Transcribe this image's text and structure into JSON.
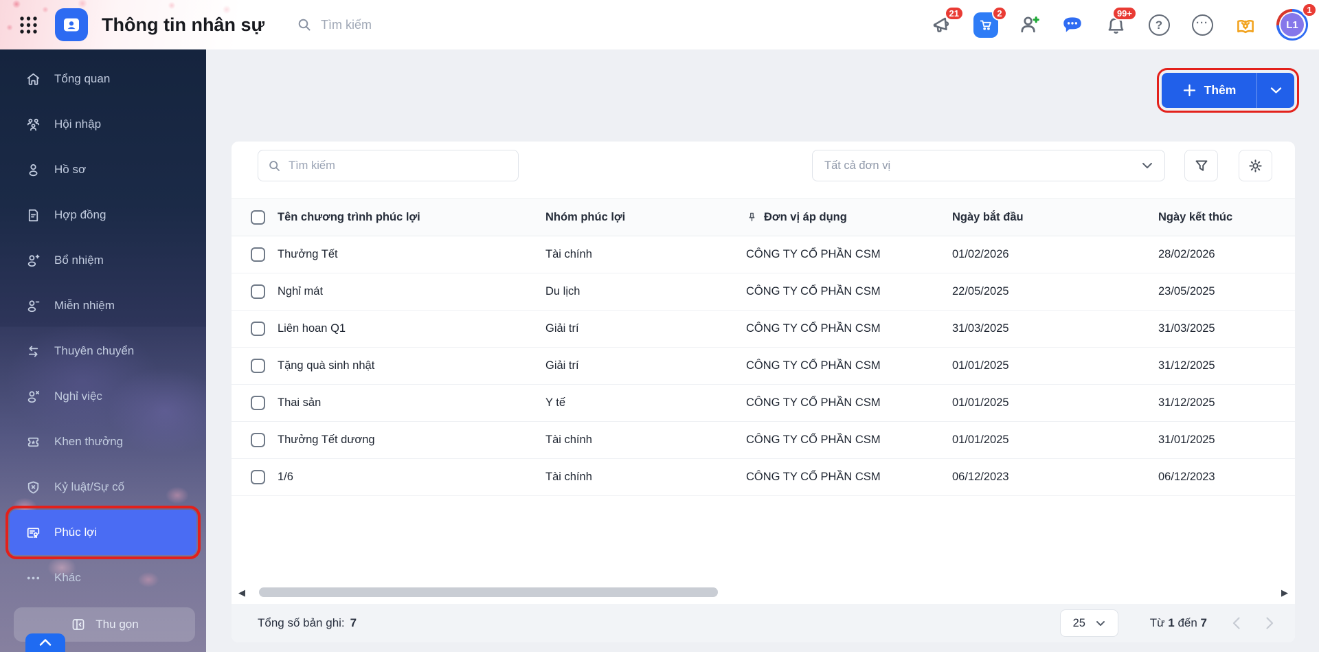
{
  "colors": {
    "accent_blue": "#2160ea",
    "sidebar_active_blue": "#4a6cf3",
    "annotation_red": "#e3211b",
    "badge_red": "#e93b34"
  },
  "header": {
    "app_title": "Thông tin nhân sự",
    "search_placeholder": "Tìm kiếm",
    "menu_icon": "grid-menu-icon",
    "app_logo_icon": "hr-app-icon",
    "actions": [
      {
        "icon": "megaphone-icon",
        "badge": "21"
      },
      {
        "icon": "cart-icon",
        "badge": "2"
      },
      {
        "icon": "person-add-icon"
      },
      {
        "icon": "chat-icon"
      },
      {
        "icon": "bell-icon",
        "badge": "99+"
      },
      {
        "icon": "help-icon",
        "glyph": "?"
      },
      {
        "icon": "more-icon",
        "glyph": "···"
      },
      {
        "icon": "handbook-icon"
      }
    ],
    "avatar": {
      "initials": "L1",
      "badge": "1"
    }
  },
  "sidebar": {
    "items": [
      {
        "label": "Tổng quan",
        "icon": "home-icon"
      },
      {
        "label": "Hội nhập",
        "icon": "people-group-icon"
      },
      {
        "label": "Hồ sơ",
        "icon": "person-icon"
      },
      {
        "label": "Hợp đồng",
        "icon": "contract-icon"
      },
      {
        "label": "Bổ nhiệm",
        "icon": "person-plus-icon"
      },
      {
        "label": "Miễn nhiệm",
        "icon": "person-minus-icon"
      },
      {
        "label": "Thuyên chuyển",
        "icon": "transfer-icon"
      },
      {
        "label": "Nghỉ việc",
        "icon": "person-x-icon"
      },
      {
        "label": "Khen thưởng",
        "icon": "reward-ticket-icon"
      },
      {
        "label": "Kỷ luật/Sự cố",
        "icon": "shield-x-icon"
      },
      {
        "label": "Phúc lợi",
        "icon": "benefit-card-icon",
        "active": true
      },
      {
        "label": "Khác",
        "icon": "ellipsis-icon"
      }
    ],
    "collapse_label": "Thu gọn",
    "collapse_icon": "collapse-panel-icon",
    "expand_icon": "chevron-up-icon"
  },
  "toolbar": {
    "add_label": "Thêm",
    "add_icon": "plus-icon",
    "add_caret_icon": "chevron-down-icon"
  },
  "filters": {
    "search_placeholder": "Tìm kiếm",
    "unit_filter_value": "Tất cả đơn vị",
    "filter_icon": "funnel-icon",
    "settings_icon": "gear-icon"
  },
  "table": {
    "columns": [
      "Tên chương trình phúc lợi",
      "Nhóm phúc lợi",
      "Đơn vị áp dụng",
      "Ngày bắt đầu",
      "Ngày kết thúc"
    ],
    "pin_icon": "pin-icon",
    "rows": [
      {
        "name": "Thưởng Tết",
        "group": "Tài chính",
        "unit": "CÔNG TY CỔ PHẦN CSM",
        "start": "01/02/2026",
        "end": "28/02/2026"
      },
      {
        "name": "Nghỉ mát",
        "group": "Du lịch",
        "unit": "CÔNG TY CỔ PHẦN CSM",
        "start": "22/05/2025",
        "end": "23/05/2025"
      },
      {
        "name": "Liên hoan Q1",
        "group": "Giải trí",
        "unit": "CÔNG TY CỔ PHẦN CSM",
        "start": "31/03/2025",
        "end": "31/03/2025"
      },
      {
        "name": "Tặng quà sinh nhật",
        "group": "Giải trí",
        "unit": "CÔNG TY CỔ PHẦN CSM",
        "start": "01/01/2025",
        "end": "31/12/2025"
      },
      {
        "name": "Thai sản",
        "group": "Y tế",
        "unit": "CÔNG TY CỔ PHẦN CSM",
        "start": "01/01/2025",
        "end": "31/12/2025"
      },
      {
        "name": "Thưởng Tết dương",
        "group": "Tài chính",
        "unit": "CÔNG TY CỔ PHẦN CSM",
        "start": "01/01/2025",
        "end": "31/01/2025"
      },
      {
        "name": "1/6",
        "group": "Tài chính",
        "unit": "CÔNG TY CỔ PHẦN CSM",
        "start": "06/12/2023",
        "end": "06/12/2023"
      }
    ]
  },
  "pagination": {
    "total_label": "Tổng số bản ghi:",
    "total_value": "7",
    "page_size": "25",
    "range_prefix": "Từ ",
    "range_from": "1",
    "range_mid": " đến ",
    "range_to": "7"
  }
}
